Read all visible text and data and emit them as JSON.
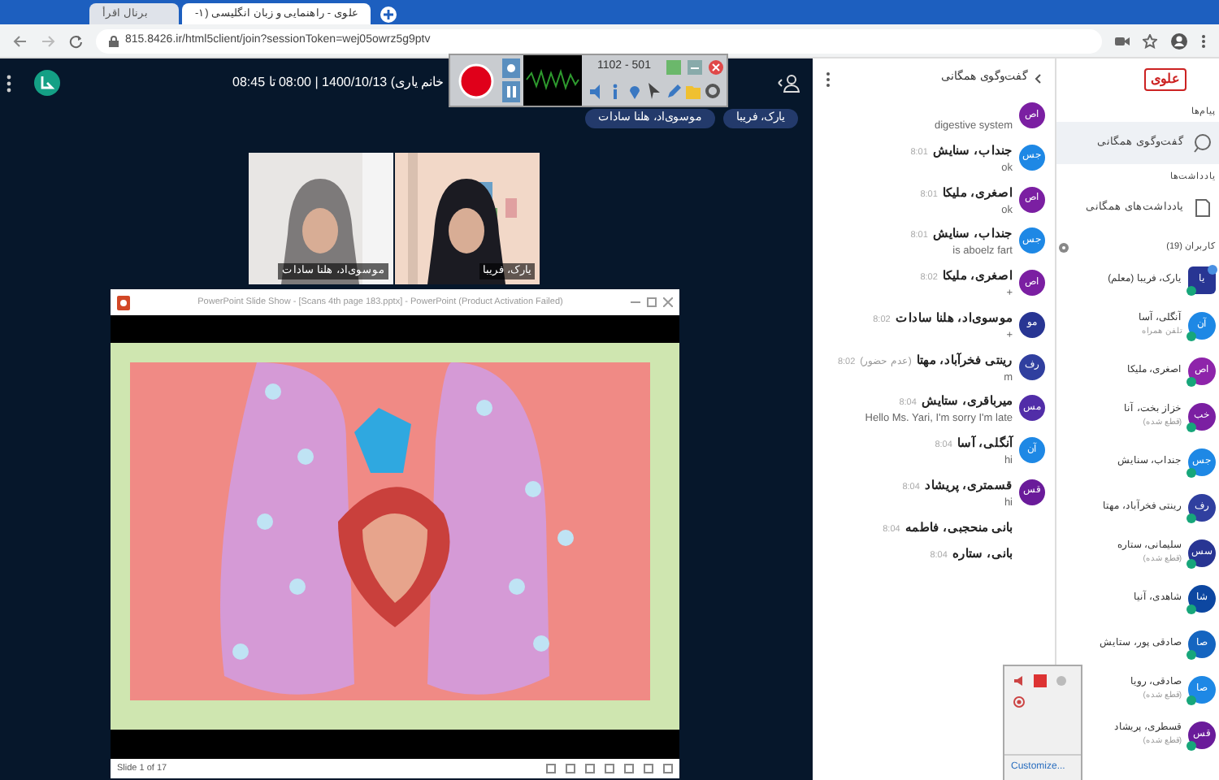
{
  "browser": {
    "tabs": [
      {
        "title": "علوی - راهنمایی و زبان انگلیسی (۱-",
        "selected": true
      },
      {
        "title": "برنال اقرأ",
        "selected": false
      }
    ],
    "url": "815.8426.ir/html5client/join?sessionToken=wej05owrz5g9ptv"
  },
  "meeting": {
    "title": "خانم یاری) 1400/10/13 | 08:00 تا 08:45",
    "recorder": {
      "size": "1102 - 501"
    },
    "talking": [
      "یارک، فریبا",
      "موسوی‌اد، هلنا سادات"
    ],
    "videos": [
      {
        "name": "یارک، فریبا"
      },
      {
        "name": "موسوی‌اد، هلنا سادات"
      }
    ]
  },
  "slide_window": {
    "title": "PowerPoint Slide Show - [Scans 4th page 183.pptx] - PowerPoint (Product Activation Failed)",
    "status": "Slide 1 of 17"
  },
  "chat": {
    "title": "گفت‌وگوی همگانی",
    "messages": [
      {
        "text": "digestive system",
        "initials": "اص",
        "color": "#7b1fa2"
      },
      {
        "name": "جنداب، سنایش",
        "time": "8:01",
        "text": "ok",
        "initials": "جس",
        "color": "#1e88e5"
      },
      {
        "name": "اصغری، ملیکا",
        "time": "8:01",
        "text": "ok",
        "initials": "اص",
        "color": "#7b1fa2"
      },
      {
        "name": "جنداب، سنایش",
        "time": "8:01",
        "text": "is aboelz fart",
        "initials": "جس",
        "color": "#1e88e5"
      },
      {
        "name": "اصغری، ملیکا",
        "time": "8:02",
        "text": "+",
        "initials": "اص",
        "color": "#7b1fa2"
      },
      {
        "name": "موسوی‌اد، هلنا سادات",
        "time": "8:02",
        "text": "+",
        "initials": "مو",
        "color": "#283593"
      },
      {
        "name": "رینتی فخرآباد، مهتا",
        "note": "(عدم حضور)",
        "time": "8:02",
        "text": "m",
        "initials": "رف",
        "color": "#303f9f"
      },
      {
        "name": "میرباقری، ستایش",
        "time": "8:04",
        "text": "Hello Ms. Yari, I'm sorry I'm late",
        "initials": "مس",
        "color": "#512da8"
      },
      {
        "name": "آنگلی، آسا",
        "time": "8:04",
        "text": "hi",
        "initials": "آن",
        "color": "#1e88e5"
      },
      {
        "name": "قسمتری، پریشاد",
        "time": "8:04",
        "text": "hi",
        "initials": "قس",
        "color": "#6a1b9a"
      },
      {
        "name": "بانی منحجبی، فاطمه",
        "time": "8:04"
      },
      {
        "name": "بانی، ستاره",
        "time": "8:04"
      }
    ]
  },
  "sidebar": {
    "logo": "علوی",
    "sections": [
      {
        "label": "پیام‌ها",
        "items": [
          {
            "label": "گفت‌وگوی همگانی",
            "selected": true
          }
        ]
      },
      {
        "label": "یادداشت‌ها",
        "items": [
          {
            "label": "یادداشت‌های همگانی",
            "selected": false
          }
        ]
      }
    ],
    "users_label": "کاربران (19)",
    "users": [
      {
        "name": "یارک، فریبا (معلم)",
        "initials": "یا",
        "color": "#283593",
        "presenter": true
      },
      {
        "name": "آنگلی، آسا",
        "status": "تلفن همراه",
        "initials": "آن",
        "color": "#1e88e5",
        "presenter": false
      },
      {
        "name": "اصغری، ملیکا",
        "initials": "اص",
        "color": "#8e24aa",
        "presenter": false
      },
      {
        "name": "خزاز بخت، آنا",
        "status": "(قطع شده)",
        "initials": "خب",
        "color": "#7b1fa2",
        "presenter": false
      },
      {
        "name": "جنداب، سنایش",
        "initials": "جس",
        "color": "#1e88e5",
        "presenter": false
      },
      {
        "name": "رینتی فخرآباد، مهتا",
        "initials": "رف",
        "color": "#303f9f",
        "presenter": false
      },
      {
        "name": "سلیمانی، ستاره",
        "status": "(قطع شده)",
        "initials": "سس",
        "color": "#283593",
        "presenter": false
      },
      {
        "name": "شاهدی، آنیا",
        "initials": "شا",
        "color": "#0d47a1",
        "presenter": false
      },
      {
        "name": "صادقی پور، ستایش",
        "initials": "صا",
        "color": "#1565c0",
        "presenter": false
      },
      {
        "name": "صادقی، رویا",
        "status": "(قطع شده)",
        "initials": "صا",
        "color": "#1e88e5",
        "presenter": false
      },
      {
        "name": "قسطری، پریشاد",
        "status": "(قطع شده)",
        "initials": "قس",
        "color": "#6a1b9a",
        "presenter": false
      }
    ]
  },
  "tray": {
    "link": "Customize..."
  }
}
